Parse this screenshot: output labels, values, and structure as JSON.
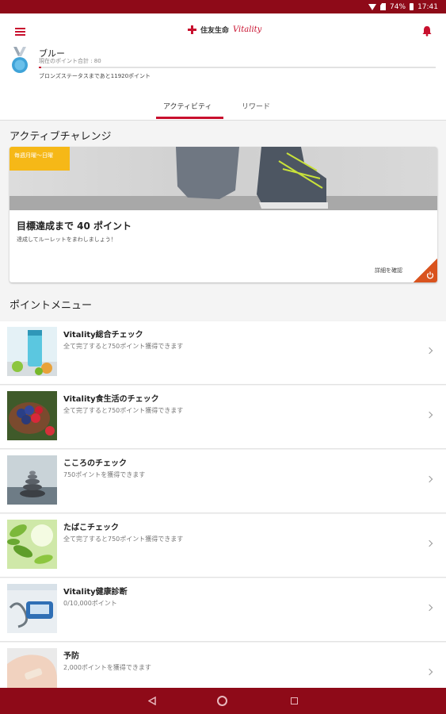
{
  "status_bar": {
    "battery": "74%",
    "time": "17:41"
  },
  "header": {
    "logo_company": "住友生命",
    "logo_vitality": "Vitality"
  },
  "profile": {
    "status_name": "ブルー",
    "points_total": "現在のポイント合計 : 80",
    "next_status": "ブロンズステータスまであと11920ポイント",
    "progress_fraction": 0.0067
  },
  "tabs": [
    {
      "label": "アクティビティ",
      "active": true
    },
    {
      "label": "リワード",
      "active": false
    }
  ],
  "active_challenge": {
    "section_title": "アクティブチャレンジ",
    "period_badge": "毎週月曜〜日曜",
    "heading": "目標達成まで 40 ポイント",
    "subtext": "達成してルーレットをまわしましょう！",
    "details_link": "詳細を確認"
  },
  "points_menu": {
    "section_title": "ポイントメニュー",
    "items": [
      {
        "title": "Vitality総合チェック",
        "desc": "全て完了すると750ポイント獲得できます",
        "icon": "shaker-fruit-photo"
      },
      {
        "title": "Vitality食生活のチェック",
        "desc": "全て完了すると750ポイント獲得できます",
        "icon": "berries-photo"
      },
      {
        "title": "こころのチェック",
        "desc": "750ポイントを獲得できます",
        "icon": "stones-photo"
      },
      {
        "title": "たばこチェック",
        "desc": "全て完了すると750ポイント獲得できます",
        "icon": "leaves-photo"
      },
      {
        "title": "Vitality健康診断",
        "desc": "0/10,000ポイント",
        "icon": "blood-pressure-photo"
      },
      {
        "title": "予防",
        "desc": "2,000ポイントを獲得できます",
        "icon": "bandage-photo"
      }
    ]
  },
  "colors": {
    "brand_red": "#c8102e",
    "status_bar": "#8e0a18",
    "badge_yellow": "#f6b817",
    "corner_orange": "#d9531e"
  }
}
